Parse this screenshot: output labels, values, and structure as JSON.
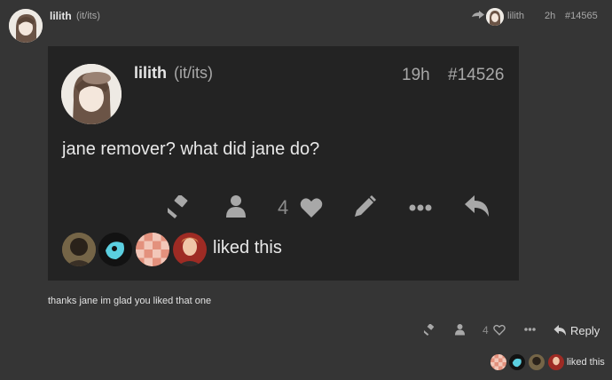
{
  "post": {
    "username": "lilith",
    "pronouns": "(it/its)",
    "reply_to_username": "lilith",
    "time": "2h",
    "post_number": "#14565",
    "body": "thanks jane im glad you liked that one",
    "like_count": "4",
    "reply_label": "Reply",
    "liked_label": "liked this"
  },
  "quote": {
    "username": "lilith",
    "pronouns": "(it/its)",
    "time": "19h",
    "post_number": "#14526",
    "body": "jane remover? what did jane do?",
    "like_count": "4",
    "liked_label": "liked this"
  },
  "icons": [
    "avatar",
    "reply-arrow-icon",
    "gavel-icon",
    "user-icon",
    "heart-icon",
    "pencil-icon",
    "ellipsis-icon",
    "reply-icon"
  ],
  "colors": {
    "background": "#353535",
    "quote_background": "#232323",
    "text": "#dddddd",
    "muted": "#a8a8a8"
  }
}
